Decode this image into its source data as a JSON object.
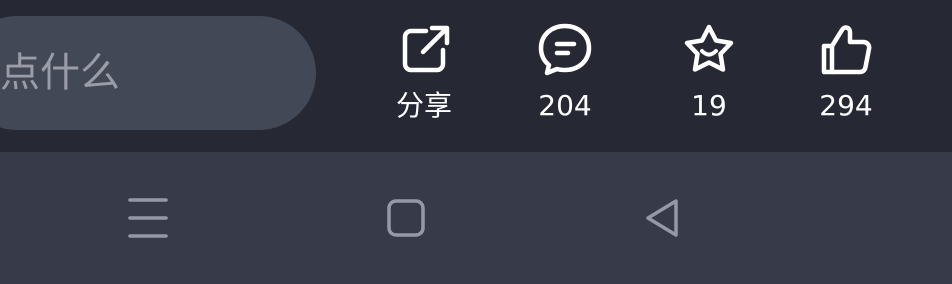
{
  "comment": {
    "placeholder": "说点什么"
  },
  "actions": {
    "share": {
      "label": "分享",
      "icon": "share-icon"
    },
    "comments": {
      "count": "204",
      "icon": "comment-icon"
    },
    "favorites": {
      "count": "19",
      "icon": "star-icon"
    },
    "likes": {
      "count": "294",
      "icon": "thumbs-up-icon"
    }
  },
  "nav": {
    "menu": {
      "icon": "menu-icon"
    },
    "home": {
      "icon": "home-square-icon"
    },
    "back": {
      "icon": "back-triangle-icon"
    }
  },
  "colors": {
    "action_bar_bg": "#262833",
    "nav_bar_bg": "#373a48",
    "input_bg": "#434857",
    "icon_white": "#ffffff",
    "nav_icon": "#9599a6"
  }
}
